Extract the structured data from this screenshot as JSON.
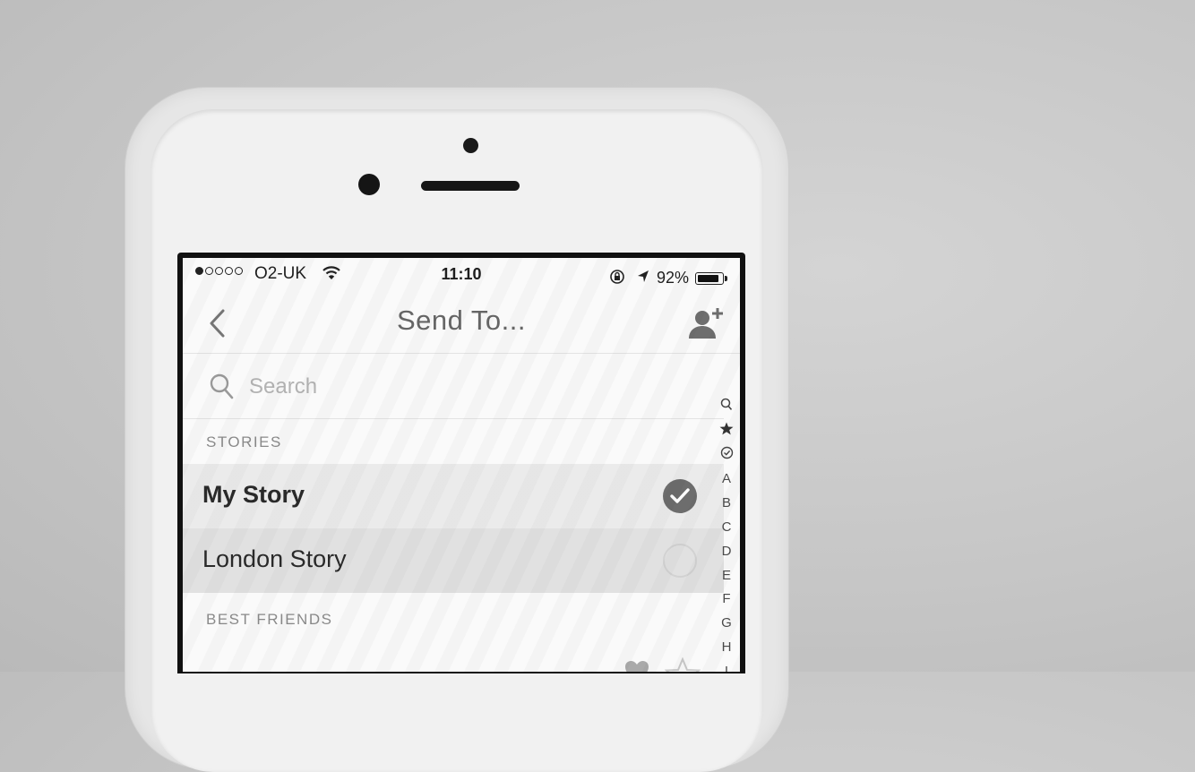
{
  "status_bar": {
    "carrier": "O2-UK",
    "time": "11:10",
    "battery": "92%",
    "battery_level": 0.92,
    "signal_bars": 1,
    "signal_total": 5
  },
  "nav": {
    "title": "Send To...",
    "back_icon": "chevron-left-icon",
    "add_friend_icon": "add-friend-icon"
  },
  "search": {
    "placeholder": "Search"
  },
  "sections": {
    "stories": "STORIES",
    "best_friends": "BEST FRIENDS"
  },
  "stories": [
    {
      "label": "My Story",
      "selected": true
    },
    {
      "label": "London Story",
      "selected": false
    }
  ],
  "index_bar": [
    "search-icon",
    "star-icon",
    "clock-icon",
    "A",
    "B",
    "C",
    "D",
    "E",
    "F",
    "G",
    "H",
    "I"
  ],
  "colors": {
    "selected_row": "#ebebeb",
    "unselected_row": "#e1e1e1",
    "check_fill": "#6d6d6d"
  }
}
